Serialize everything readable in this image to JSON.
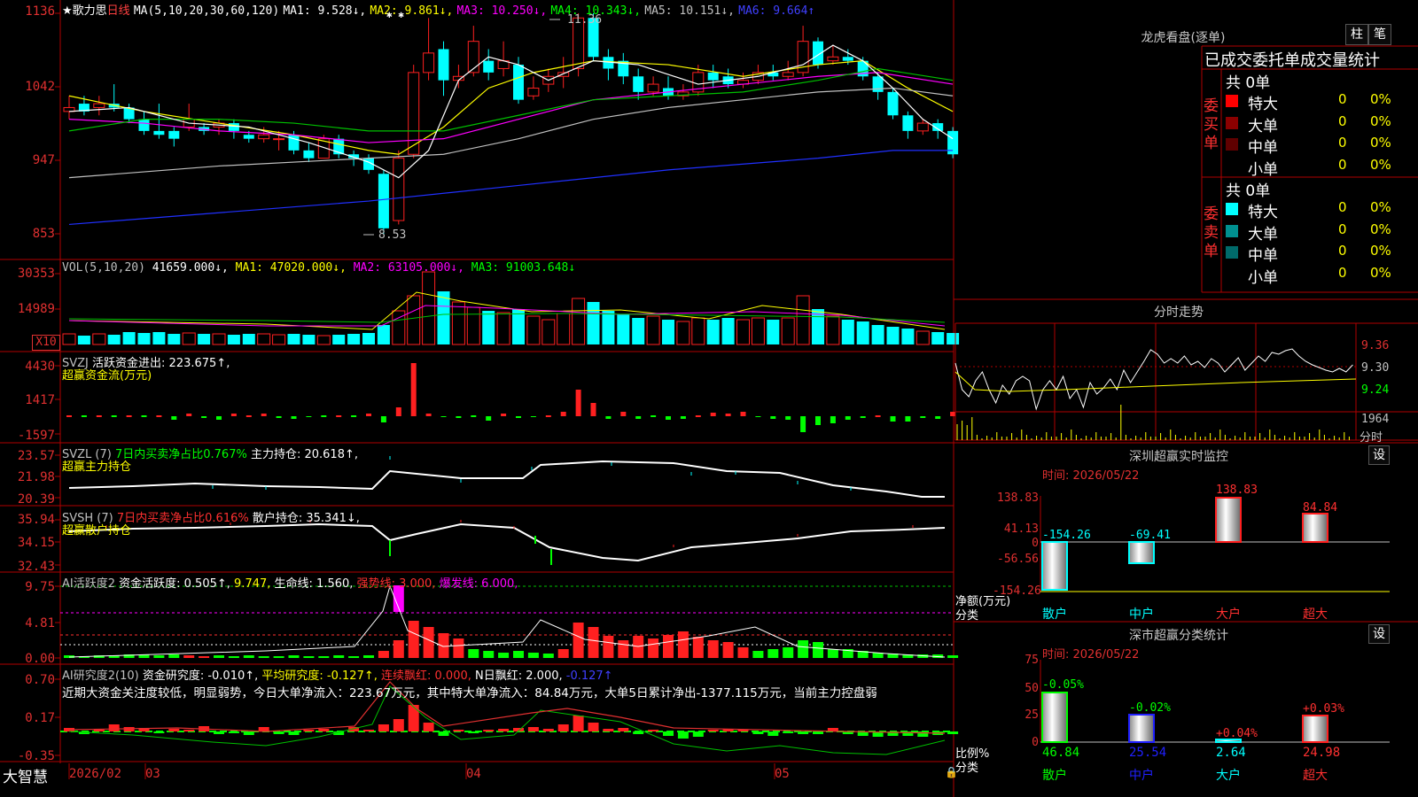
{
  "main": {
    "title_star": "★",
    "stock_name": "歌力思",
    "period": "日线",
    "ma_header": "MA(5,10,20,30,60,120)",
    "ma1": "MA1: 9.528↓,",
    "ma2": "MA2: 9.861↓,",
    "ma3": "MA3: 10.250↓,",
    "ma4": "MA4: 10.343↓,",
    "ma5": "MA5: 10.151↓,",
    "ma6": "MA6: 9.664↑",
    "axis": [
      "1136",
      "1042",
      "947",
      "853"
    ],
    "high_label": "11.36",
    "low_label": "8.53",
    "markers": "✱ ✱"
  },
  "vol": {
    "header": "VOL(5,10,20)",
    "value": "41659.000↓,",
    "ma1": "MA1: 47020.000↓,",
    "ma2": "MA2: 63105.000↓,",
    "ma3": "MA3: 91003.648↓",
    "axis": [
      "30353",
      "14989"
    ],
    "unit": "X10"
  },
  "svzj": {
    "header": "SVZJ",
    "label": "活跃资金进出: 223.675↑,",
    "sub": "超赢资金流(万元)",
    "axis": [
      "4430",
      "1417",
      "-1597"
    ]
  },
  "svzl": {
    "header": "SVZL (7)",
    "label1": "7日内买卖净占比0.767%",
    "label2": "主力持仓: 20.618↑,",
    "sub": "超赢主力持仓",
    "axis": [
      "23.57",
      "21.98",
      "20.39"
    ]
  },
  "svsh": {
    "header": "SVSH (7)",
    "label1": "7日内买卖净占比0.616%",
    "label2": "散户持仓: 35.341↓,",
    "sub": "超赢散户持仓",
    "axis": [
      "35.94",
      "34.15",
      "32.43"
    ]
  },
  "ai1": {
    "header": "AI活跃度2",
    "label1": "资金活跃度: 0.505↑,",
    "label2": "9.747,",
    "label3": "生命线: 1.560,",
    "label4": "强势线: 3.000,",
    "label5": "爆发线: 6.000,",
    "axis": [
      "9.75",
      "4.81",
      "0.00"
    ]
  },
  "ai2": {
    "header": "AI研究度2(10)",
    "label1": "资金研究度: -0.010↑,",
    "label2": "平均研究度: -0.127↑,",
    "label3": "连续飘红: 0.000,",
    "label4": "N日飘红: 2.000,",
    "label5": "-0.127↑",
    "comment": "近期大资金关注度较低，明显弱势，今日大单净流入：223.67万元，其中特大单净流入：84.84万元，大单5日累计净出-1377.115万元，当前主力控盘弱",
    "axis": [
      "0.70",
      "0.17",
      "-0.35"
    ]
  },
  "timeline": {
    "brand": "大智慧",
    "labels": [
      "2026/02",
      "03",
      "04",
      "05"
    ]
  },
  "dragon": {
    "title": "龙虎看盘(逐单)",
    "btn_column": "柱",
    "btn_pen": "笔",
    "subtitle": "已成交委托单成交量统计",
    "buy_label": "委买单",
    "sell_label": "委卖单",
    "buy_total": "共 0单",
    "sell_total": "共 0单",
    "buy_rows": [
      {
        "name": "特大",
        "count": "0",
        "pct": "0%",
        "color": "#ff0000"
      },
      {
        "name": "大单",
        "count": "0",
        "pct": "0%",
        "color": "#8b0000"
      },
      {
        "name": "中单",
        "count": "0",
        "pct": "0%",
        "color": "#600000"
      },
      {
        "name": "小单",
        "count": "0",
        "pct": "0%",
        "color": ""
      }
    ],
    "sell_rows": [
      {
        "name": "特大",
        "count": "0",
        "pct": "0%",
        "color": "#00ffff"
      },
      {
        "name": "大单",
        "count": "0",
        "pct": "0%",
        "color": "#009090"
      },
      {
        "name": "中单",
        "count": "0",
        "pct": "0%",
        "color": "#006a6a"
      },
      {
        "name": "小单",
        "count": "0",
        "pct": "0%",
        "color": ""
      }
    ]
  },
  "intraday": {
    "title": "分时走势",
    "axis": [
      "9.36",
      "9.30",
      "9.24"
    ],
    "vol_label": "1964",
    "vol_unit": "分时"
  },
  "monitor": {
    "title": "深圳超赢实时监控",
    "settings": "设",
    "time": "时间: 2026/05/22",
    "axis": [
      "138.83",
      "41.13",
      "0",
      "-56.56",
      "-154.26"
    ],
    "axis_title": "净额(万元)",
    "cat_title": "分类",
    "categories": [
      "散户",
      "中户",
      "大户",
      "超大"
    ],
    "values": [
      "-154.26",
      "-69.41",
      "138.83",
      "84.84"
    ]
  },
  "classify": {
    "title": "深市超赢分类统计",
    "settings": "设",
    "time": "时间: 2026/05/22",
    "axis": [
      "75",
      "50",
      "25",
      "0"
    ],
    "axis_title": "比例%",
    "cat_title": "分类",
    "categories": [
      "散户",
      "中户",
      "大户",
      "超大"
    ],
    "changes": [
      "-0.05%",
      "-0.02%",
      "+0.04%",
      "+0.03%"
    ],
    "values": [
      "46.84",
      "25.54",
      "2.64",
      "24.98"
    ]
  },
  "colors": {
    "up": "#ff2020",
    "down": "#00ffff",
    "grid": "#b00000"
  }
}
